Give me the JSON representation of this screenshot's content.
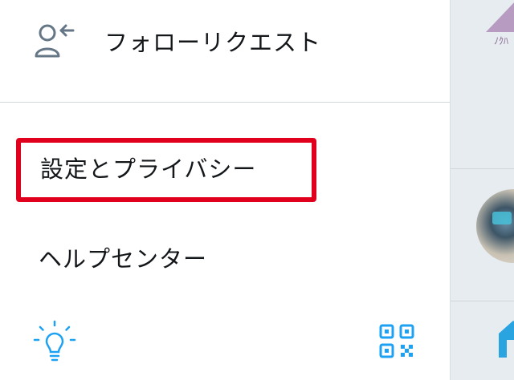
{
  "menu": {
    "follow_requests": "フォローリクエスト",
    "settings_privacy": "設定とプライバシー",
    "help_center": "ヘルプセンター"
  },
  "right_pane": {
    "banner_text": "ﾉｸﾊ"
  },
  "colors": {
    "highlight": "#e0001e",
    "accent": "#1da1f2",
    "icon_gray": "#657786",
    "pane_bg": "#e6ecf0"
  },
  "icons": {
    "follow_requests": "person-arrow-icon",
    "bulb": "lightbulb-icon",
    "qr": "qr-code-icon",
    "home": "home-icon"
  }
}
